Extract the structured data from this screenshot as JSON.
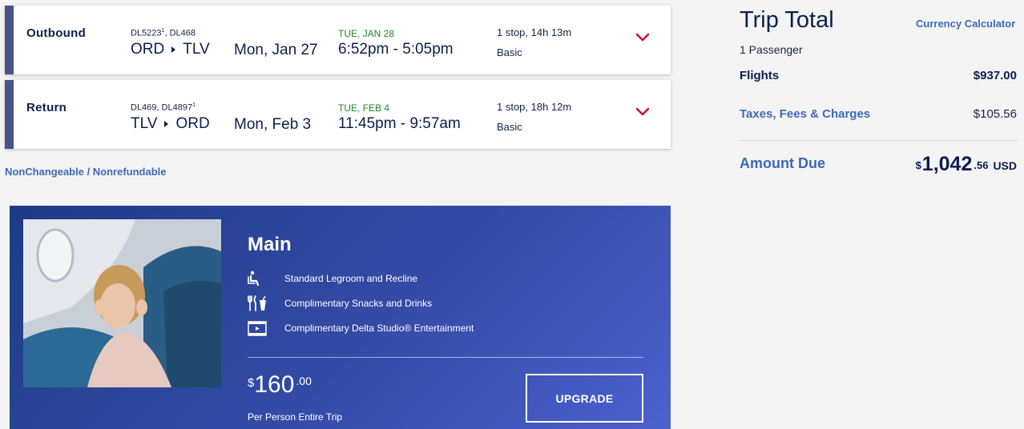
{
  "flights": [
    {
      "direction": "Outbound",
      "flight_numbers": [
        {
          "num": "DL5223",
          "sup": "1"
        },
        {
          "num": "DL468",
          "sup": ""
        }
      ],
      "from": "ORD",
      "to": "TLV",
      "depart_date": "Mon, Jan 27",
      "arrival_day": "TUE, JAN 28",
      "times": "6:52pm - 5:05pm",
      "stops": "1 stop, 14h 13m",
      "fare_class": "Basic"
    },
    {
      "direction": "Return",
      "flight_numbers": [
        {
          "num": "DL469",
          "sup": ""
        },
        {
          "num": "DL4897",
          "sup": "1"
        }
      ],
      "from": "TLV",
      "to": "ORD",
      "depart_date": "Mon, Feb 3",
      "arrival_day": "TUE, FEB 4",
      "times": "11:45pm - 9:57am",
      "stops": "1 stop, 18h 12m",
      "fare_class": "Basic"
    }
  ],
  "policy_link": "NonChangeable / Nonrefundable",
  "upsell": {
    "title": "Main",
    "features": [
      {
        "icon": "seat-icon",
        "label": "Standard Legroom and Recline"
      },
      {
        "icon": "utensils-drink-icon",
        "label": "Complimentary Snacks and Drinks"
      },
      {
        "icon": "film-icon",
        "label": "Complimentary Delta Studio® Entertainment"
      }
    ],
    "price": {
      "currency_symbol": "$",
      "whole": "160",
      "cents": ".00"
    },
    "price_note": "Per Person Entire Trip",
    "button_label": "UPGRADE"
  },
  "trip_total": {
    "title": "Trip Total",
    "currency_link": "Currency Calculator",
    "passengers": "1 Passenger",
    "flights_label": "Flights",
    "flights_amount": "$937.00",
    "taxes_label": "Taxes, Fees & Charges",
    "taxes_amount": "$105.56",
    "due_label": "Amount Due",
    "due": {
      "currency_symbol": "$",
      "whole": "1,042",
      "cents": ".56",
      "code": "USD"
    }
  },
  "colors": {
    "accent_blue": "#3e69b6",
    "navy": "#0b1f4e",
    "arrival_green": "#1b8a2b",
    "chevron_red": "#c8102e"
  }
}
